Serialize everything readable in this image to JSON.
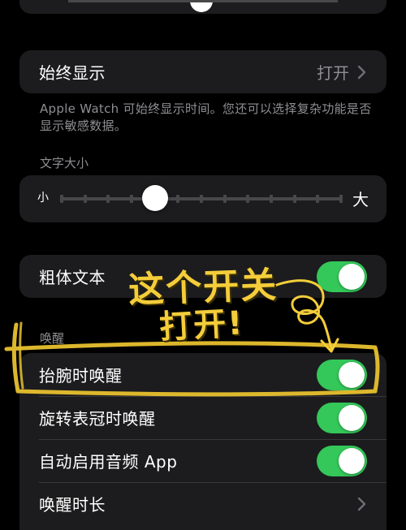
{
  "always_on": {
    "label": "始终显示",
    "value": "打开",
    "caption": "Apple Watch 可始终显示时间。您还可以选择复杂功能是否显示敏感数据。"
  },
  "text_size": {
    "header": "文字大小",
    "small_label": "小",
    "large_label": "大",
    "steps": 12,
    "current_step": 4
  },
  "bold_text": {
    "label": "粗体文本",
    "on": true
  },
  "wake": {
    "header": "唤醒",
    "rows": [
      {
        "label": "抬腕时唤醒",
        "on": true
      },
      {
        "label": "旋转表冠时唤醒",
        "on": true
      },
      {
        "label": "自动启用音频 App",
        "on": true
      }
    ],
    "duration_label": "唤醒时长"
  },
  "annotation": {
    "line1": "这个开关",
    "line2": "打开!"
  },
  "colors": {
    "background": "#000000",
    "cell": "#1c1c1e",
    "toggle_on": "#34c759",
    "secondary_text": "#8e8e93",
    "annotation": "#f4cd3a"
  }
}
